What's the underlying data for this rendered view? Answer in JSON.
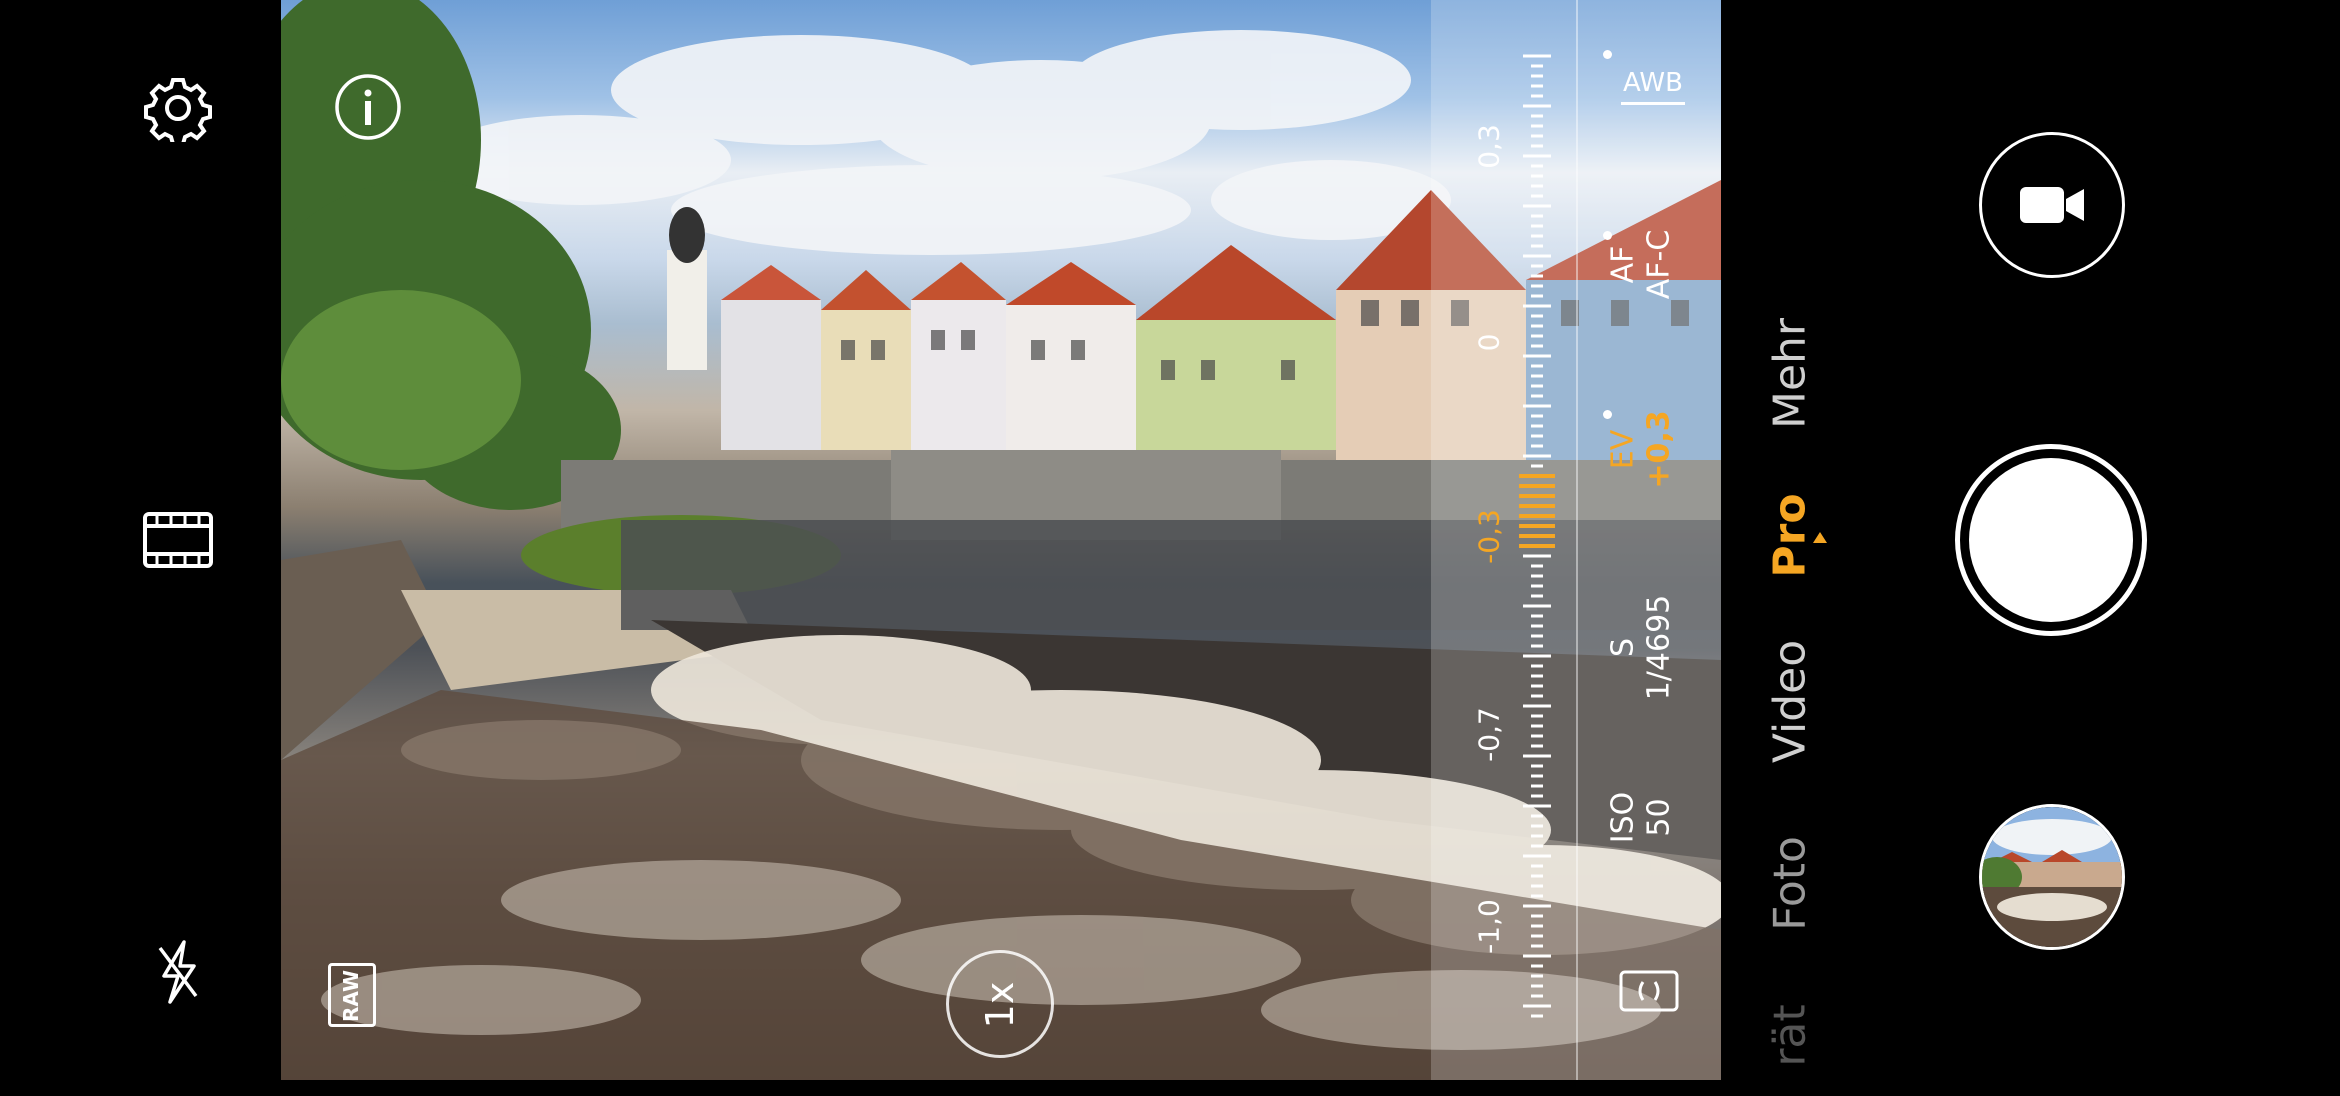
{
  "left_controls": {
    "settings_icon": "gear-icon",
    "video_format_icon": "film-icon",
    "flash_icon": "flash-off-icon"
  },
  "viewfinder": {
    "info_icon": "info-icon",
    "raw_label": "RAW",
    "zoom_label": "1x"
  },
  "pro_panel": {
    "awb_label": "AWB",
    "af_label": "AF",
    "af_value": "AF-C",
    "ev_label": "EV",
    "ev_value": "+0,3",
    "s_label": "S",
    "s_value": "1/4695",
    "iso_label": "ISO",
    "iso_value": "50",
    "scale_labels": [
      "0,3",
      "0",
      "-0,3",
      "-0,7",
      "-1,0"
    ],
    "metering_icon": "metering-icon",
    "accent_color": "#f5a623"
  },
  "modes": {
    "items": [
      "rät",
      "Foto",
      "Video",
      "Pro",
      "Mehr"
    ],
    "active": "Pro"
  },
  "right_controls": {
    "video_icon": "video-camera-icon",
    "shutter": "shutter-button",
    "gallery": "gallery-thumbnail"
  }
}
